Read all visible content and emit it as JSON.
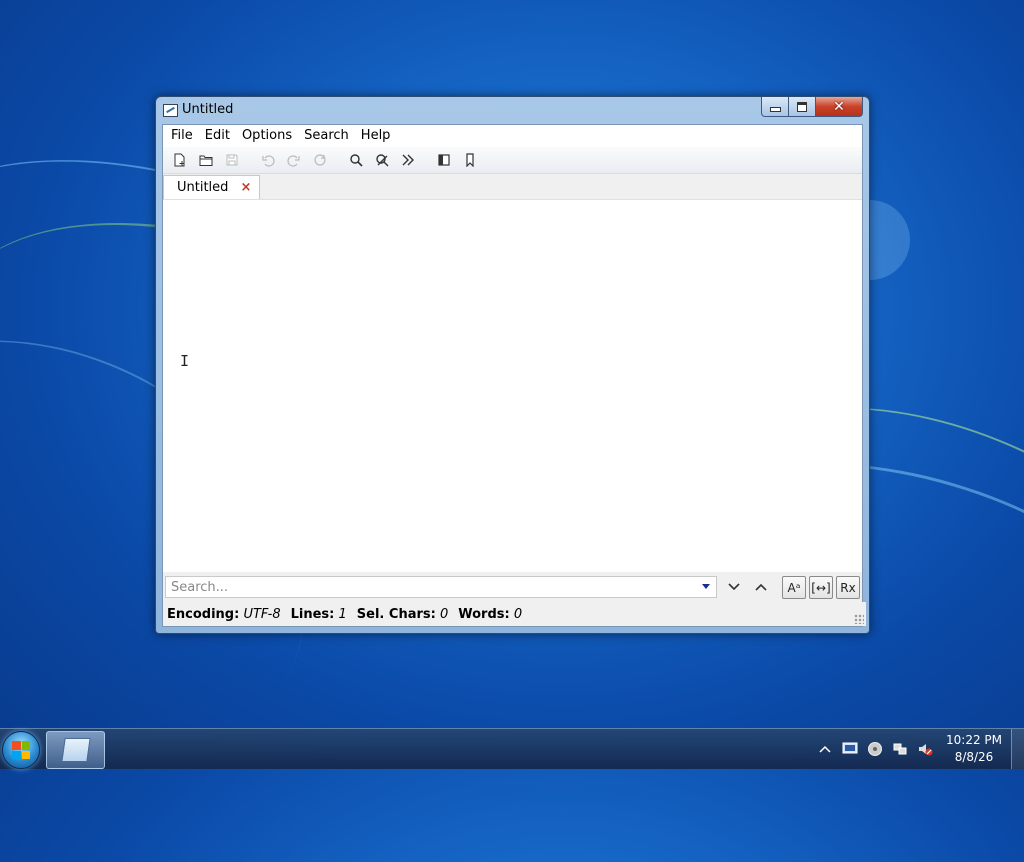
{
  "window": {
    "title": "Untitled"
  },
  "menu": [
    "File",
    "Edit",
    "Options",
    "Search",
    "Help"
  ],
  "toolbar": {
    "icons": [
      "new-file-icon",
      "open-folder-icon",
      "save-icon",
      "undo-icon",
      "redo-icon",
      "redo-all-icon",
      "find-icon",
      "find-replace-icon",
      "more-icon",
      "sidebar-toggle-icon",
      "bookmark-icon"
    ]
  },
  "tab": {
    "label": "Untitled",
    "close_glyph": "×"
  },
  "search": {
    "placeholder": "Search...",
    "case_label": "Aᵃ",
    "word_label": "[↔]",
    "regex_label": "Rx"
  },
  "status": {
    "encoding_key": "Encoding:",
    "encoding_val": "UTF-8",
    "lines_key": "Lines:",
    "lines_val": "1",
    "selchars_key": "Sel. Chars:",
    "selchars_val": "0",
    "words_key": "Words:",
    "words_val": "0"
  },
  "taskbar": {
    "time": "10:22 PM",
    "date": "8/8/26"
  },
  "colors": {
    "desktop": "#1565c5",
    "close_button": "#c7432a",
    "tab_close": "#c0392b"
  }
}
